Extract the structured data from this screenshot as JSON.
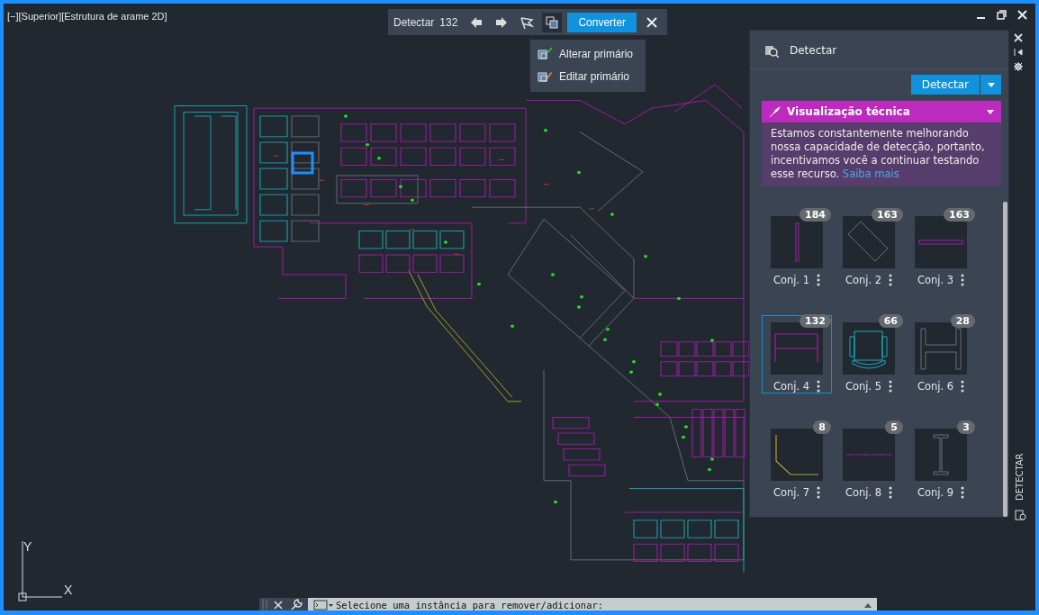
{
  "viewport": {
    "label": "[−][Superior][Estrutura de arame 2D]"
  },
  "toolbar": {
    "title": "Detectar",
    "count": "132",
    "convert_button": "Converter"
  },
  "menu": {
    "items": [
      {
        "label": "Alterar primário",
        "kind": "change"
      },
      {
        "label": "Editar primário",
        "kind": "edit"
      }
    ]
  },
  "panel": {
    "title": "Detectar",
    "detect_button": "Detectar",
    "banner": {
      "title": "Visualização técnica",
      "text": "Estamos constantemente melhorando nossa capacidade de detecção, portanto, incentivamos você a continuar testando esse recurso.",
      "link": "Saiba mais",
      "expanded": true
    },
    "sets": [
      {
        "label": "Conj. 1",
        "count": "184",
        "kind": "vline",
        "selected": false
      },
      {
        "label": "Conj. 2",
        "count": "163",
        "kind": "diamond",
        "selected": false
      },
      {
        "label": "Conj. 3",
        "count": "163",
        "kind": "hbar",
        "selected": false
      },
      {
        "label": "Conj. 4",
        "count": "132",
        "kind": "desk",
        "selected": true
      },
      {
        "label": "Conj. 5",
        "count": "66",
        "kind": "chair",
        "selected": false
      },
      {
        "label": "Conj. 6",
        "count": "28",
        "kind": "hbeam",
        "selected": false
      },
      {
        "label": "Conj. 7",
        "count": "8",
        "kind": "corner",
        "selected": false
      },
      {
        "label": "Conj. 8",
        "count": "5",
        "kind": "dashline",
        "selected": false
      },
      {
        "label": "Conj. 9",
        "count": "3",
        "kind": "ibeam",
        "selected": false
      }
    ]
  },
  "side_tab": {
    "label": "DETECTAR"
  },
  "ucs": {
    "x": "X",
    "y": "Y"
  },
  "command_line": {
    "prompt": "Selecione uma instância para remover/adicionar:"
  }
}
